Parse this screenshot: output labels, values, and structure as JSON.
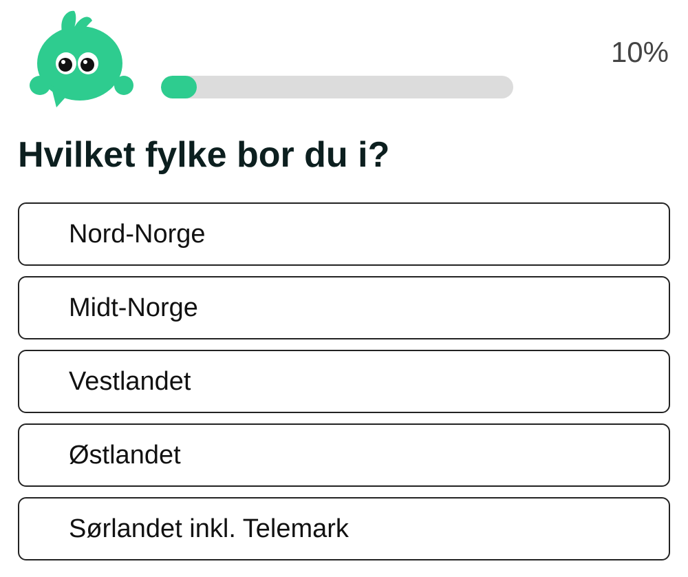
{
  "progress": {
    "value": 0.1,
    "label": "10%",
    "fill_color": "#2ecc8f",
    "track_color": "#dcdcdc"
  },
  "mascot": {
    "icon": "green-bird-mascot-icon",
    "color": "#2ecc8f"
  },
  "question": "Hvilket fylke bor du i?",
  "options": [
    {
      "label": "Nord-Norge"
    },
    {
      "label": "Midt-Norge"
    },
    {
      "label": "Vestlandet"
    },
    {
      "label": "Østlandet"
    },
    {
      "label": "Sørlandet inkl. Telemark"
    }
  ]
}
